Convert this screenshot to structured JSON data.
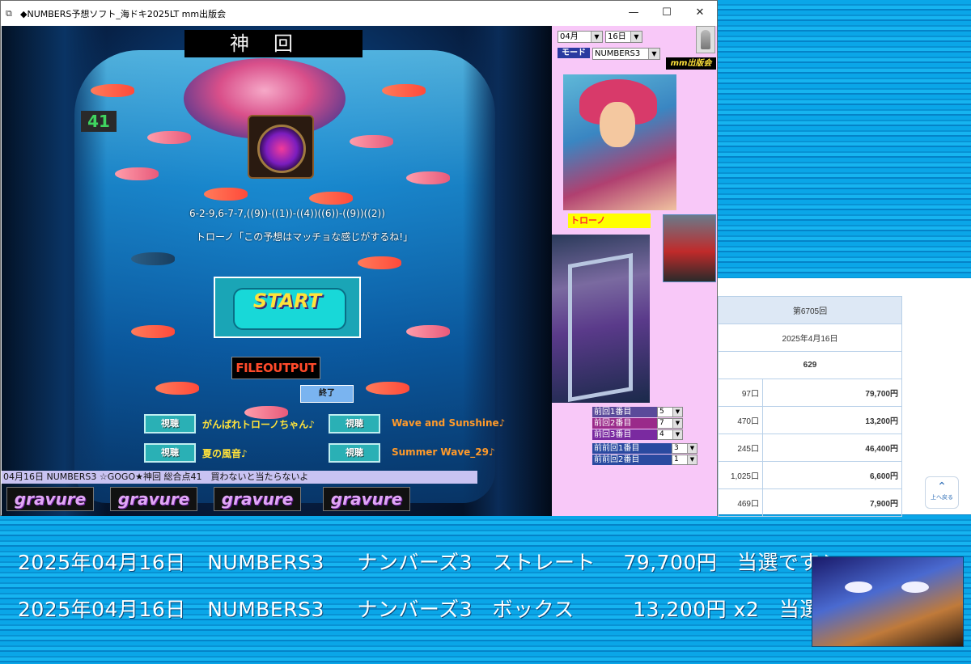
{
  "window": {
    "title": "◆NUMBERS予想ソフト_海ドキ2025LT  mm出版会",
    "controls": {
      "minimize": "—",
      "maximize": "☐",
      "close": "✕"
    }
  },
  "game": {
    "logo": "神回",
    "counter": "41",
    "prediction": "6-2-9,6-7-7,((9))-((1))-((4))((6))-((9))((2))",
    "quote": "トローノ「この予想はマッチョな感じがするね!」",
    "start_label": "START",
    "fileoutput_label": "FILEOUTPUT",
    "end_label": "終了",
    "listen_label": "視聴",
    "songs": [
      "がんばれトローノちゃん♪",
      "Wave and Sunshine♪",
      "夏の風音♪",
      "Summer Wave_29♪"
    ],
    "status": "04月16日 NUMBERS3 ☆GOGO★神回 総合点41　買わないと当たらないよ",
    "gravure_label": "gravure"
  },
  "panel": {
    "month": "04月",
    "day": "16日",
    "mode_label": "モード",
    "mode_value": "NUMBERS3",
    "publisher": "mm出版会",
    "character_name": "トローノ",
    "previous": [
      {
        "label": "前回1番目",
        "value": "5",
        "color": "#5a4a9a"
      },
      {
        "label": "前回2番目",
        "value": "7",
        "color": "#9a2a8a"
      },
      {
        "label": "前回3番目",
        "value": "4",
        "color": "#7a2aa0"
      },
      {
        "label": "前前回1番目",
        "value": "3",
        "color": "#2a4aa0"
      },
      {
        "label": "前前回2番目",
        "value": "1",
        "color": "#2a4aa0"
      }
    ]
  },
  "web": {
    "round": "第6705回",
    "date": "2025年4月16日",
    "number": "629",
    "rows": [
      {
        "count": "97口",
        "amount": "79,700円"
      },
      {
        "count": "470口",
        "amount": "13,200円"
      },
      {
        "count": "245口",
        "amount": "46,400円"
      },
      {
        "count": "1,025口",
        "amount": "6,600円"
      },
      {
        "count": "469口",
        "amount": "7,900円"
      }
    ],
    "back_to_top": "上へ戻る"
  },
  "announcement": {
    "line1": [
      "2025年04月16日",
      "NUMBERS3",
      "ナンバーズ3",
      "ストレート",
      "79,700円",
      "当選です♪"
    ],
    "line2": [
      "2025年04月16日",
      "NUMBERS3",
      "ナンバーズ3",
      "ボックス",
      "13,200円 x2",
      "当選です♪"
    ]
  },
  "colors": {
    "panel_bg": "#f8c8f8",
    "accent_yellow": "#ffe23a",
    "stripe_blue": "#0aa6e8"
  }
}
